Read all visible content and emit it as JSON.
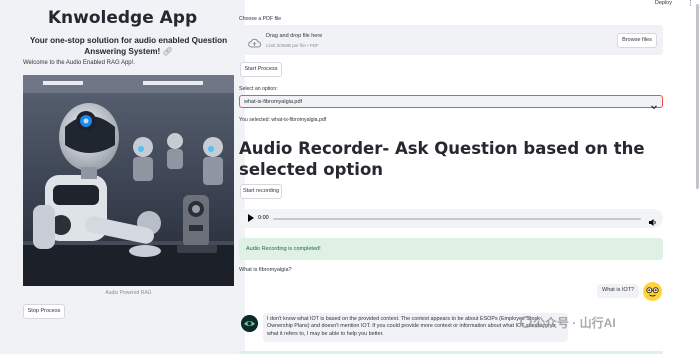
{
  "sidebar": {
    "title": "Knwoledge App",
    "subtitle": "Your one-stop solution for audio enabled Question Answering System!",
    "welcome": "Welcome to the Audio Enabled RAG App!.",
    "image_caption": "Audio Powered RAG",
    "stop_button": "Stop Process"
  },
  "header": {
    "deploy": "Deploy",
    "menu_icon": "kebab-menu-icon"
  },
  "upload": {
    "label": "Choose a PDF file",
    "drag_text": "Drag and drop file here",
    "limit_text": "Limit 200MB per file • PDF",
    "browse_button": "Browse files",
    "icon": "cloud-upload-icon"
  },
  "start_button": "Start Process",
  "select": {
    "label": "Select an option:",
    "value": "what-is-fibromyalgia.pdf",
    "selected_text": "You selected: what-is-fibromyalgia.pdf"
  },
  "section_title": "Audio Recorder- Ask Question based on the selected option",
  "record_button": "Start recording",
  "audio": {
    "time": "0:00",
    "progress": 0
  },
  "success": "Audio Recording is completed!",
  "question": "What is fibromyalgia?",
  "chat": {
    "user_message": "What is IOT?",
    "bot_message": "I don't know what IOT is based on the provided context. The context appears to be about ESOPs (Employee Stock Ownership Plans) and doesn't mention IOT. If you could provide more context or information about what IOT stands for or what it refers to, I may be able to help you better."
  },
  "watermark": "公众号 · 山行AI",
  "colors": {
    "sidebar_bg": "#f0f2f6",
    "accent_red": "#ff4b4b",
    "success_bg": "#dff0e4",
    "success_text": "#1f6b3a"
  }
}
